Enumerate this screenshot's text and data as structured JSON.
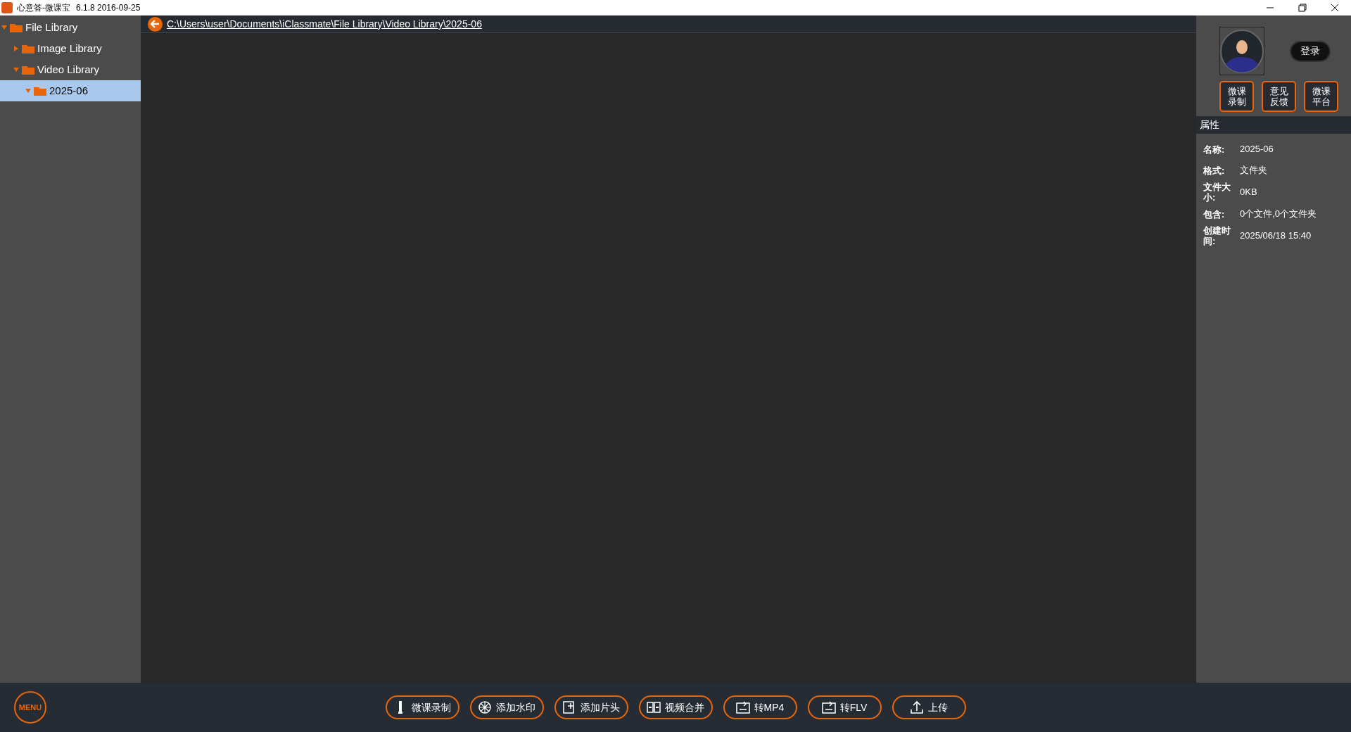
{
  "window": {
    "title": "心意答-微课宝",
    "version": "6.1.8 2016-09-25"
  },
  "tree": [
    {
      "label": "File Library",
      "expanded": true,
      "selected": false,
      "children": [
        {
          "label": "Image Library",
          "expanded": false,
          "selected": false
        },
        {
          "label": "Video Library",
          "expanded": true,
          "selected": false,
          "children": [
            {
              "label": "2025-06",
              "expanded": true,
              "selected": true
            }
          ]
        }
      ]
    }
  ],
  "path": "C:\\Users\\user\\Documents\\iClassmate\\File Library\\Video Library\\2025-06",
  "login_button": "登录",
  "quick_buttons": [
    [
      "微课",
      "录制"
    ],
    [
      "意见",
      "反馈"
    ],
    [
      "微课",
      "平台"
    ]
  ],
  "properties": {
    "title": "属性",
    "rows": [
      {
        "label": "名称:",
        "value": "2025-06"
      },
      {
        "label": "格式:",
        "value": "文件夹"
      },
      {
        "label": "文件大小:",
        "value": "0KB"
      },
      {
        "label": "包含:",
        "value": "0个文件,0个文件夹"
      },
      {
        "label": "创建时间:",
        "value": "2025/06/18  15:40"
      }
    ]
  },
  "menu_button": "MENU",
  "toolbar": [
    {
      "kind": "record",
      "label": "微课录制"
    },
    {
      "kind": "watermark",
      "label": "添加水印"
    },
    {
      "kind": "intro",
      "label": "添加片头"
    },
    {
      "kind": "merge",
      "label": "视频合并"
    },
    {
      "kind": "mp4",
      "label": "转MP4"
    },
    {
      "kind": "flv",
      "label": "转FLV"
    },
    {
      "kind": "upload",
      "label": "上传"
    }
  ]
}
